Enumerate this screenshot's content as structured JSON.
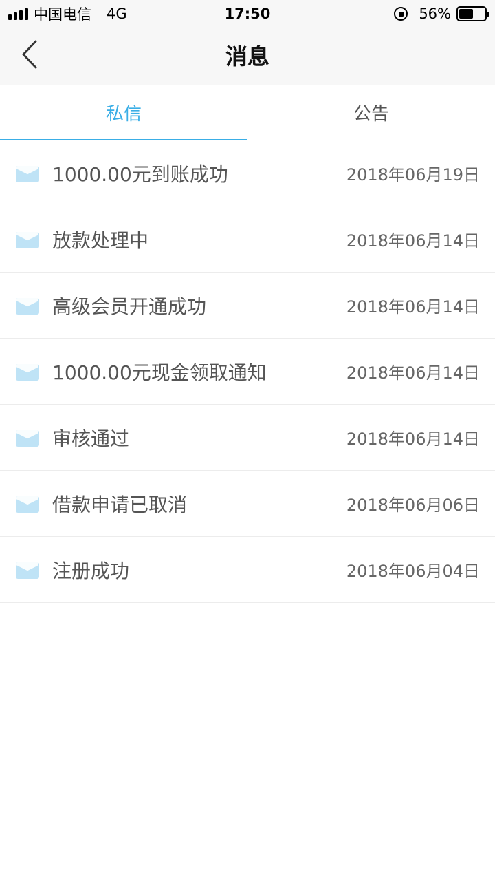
{
  "status_bar": {
    "carrier": "中国电信",
    "network": "4G",
    "time": "17:50",
    "battery": "56%",
    "battery_level": 0.56
  },
  "nav": {
    "title": "消息",
    "back_icon": "chevron-left-icon"
  },
  "tabs": [
    {
      "label": "私信",
      "active": true
    },
    {
      "label": "公告",
      "active": false
    }
  ],
  "colors": {
    "accent": "#3aaee6",
    "mail_icon": "#bfe3f6"
  },
  "messages": [
    {
      "title": "1000.00元到账成功",
      "date": "2018年06月19日",
      "icon": "mail-icon"
    },
    {
      "title": "放款处理中",
      "date": "2018年06月14日",
      "icon": "mail-icon"
    },
    {
      "title": "高级会员开通成功",
      "date": "2018年06月14日",
      "icon": "mail-icon"
    },
    {
      "title": "1000.00元现金领取通知",
      "date": "2018年06月14日",
      "icon": "mail-icon"
    },
    {
      "title": "审核通过",
      "date": "2018年06月14日",
      "icon": "mail-icon"
    },
    {
      "title": "借款申请已取消",
      "date": "2018年06月06日",
      "icon": "mail-icon"
    },
    {
      "title": "注册成功",
      "date": "2018年06月04日",
      "icon": "mail-icon"
    }
  ]
}
